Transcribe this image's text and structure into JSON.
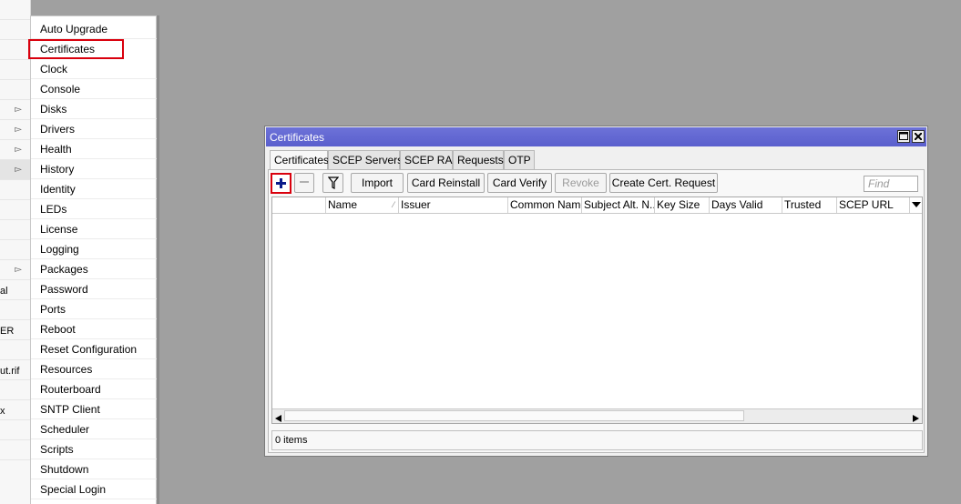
{
  "left_strip": {
    "fragments": [
      {
        "text": "al",
        "row": 14
      },
      {
        "text": "ER",
        "row": 16
      },
      {
        "text": "ut.rif",
        "row": 18
      },
      {
        "text": "x",
        "row": 20
      }
    ]
  },
  "submenu": {
    "items": [
      {
        "label": "Auto Upgrade"
      },
      {
        "label": "Certificates",
        "highlighted": true
      },
      {
        "label": "Clock"
      },
      {
        "label": "Console"
      },
      {
        "label": "Disks"
      },
      {
        "label": "Drivers"
      },
      {
        "label": "Health"
      },
      {
        "label": "History"
      },
      {
        "label": "Identity"
      },
      {
        "label": "LEDs"
      },
      {
        "label": "License"
      },
      {
        "label": "Logging"
      },
      {
        "label": "Packages"
      },
      {
        "label": "Password"
      },
      {
        "label": "Ports"
      },
      {
        "label": "Reboot"
      },
      {
        "label": "Reset Configuration"
      },
      {
        "label": "Resources"
      },
      {
        "label": "Routerboard"
      },
      {
        "label": "SNTP Client"
      },
      {
        "label": "Scheduler"
      },
      {
        "label": "Scripts"
      },
      {
        "label": "Shutdown"
      },
      {
        "label": "Special Login"
      }
    ]
  },
  "window": {
    "title": "Certificates",
    "tabs": [
      {
        "label": "Certificates",
        "active": true
      },
      {
        "label": "SCEP Servers"
      },
      {
        "label": "SCEP RA"
      },
      {
        "label": "Requests"
      },
      {
        "label": "OTP"
      }
    ],
    "toolbar": {
      "import": "Import",
      "card_reinstall": "Card Reinstall",
      "card_verify": "Card Verify",
      "revoke": "Revoke",
      "create_request": "Create Cert. Request",
      "find_placeholder": "Find"
    },
    "columns": [
      "",
      "Name",
      "Issuer",
      "Common Name",
      "Subject Alt. N...",
      "Key Size",
      "Days Valid",
      "Trusted",
      "SCEP URL"
    ],
    "status": "0 items"
  },
  "colors": {
    "titlebar": "#5a5fcd",
    "highlight": "#d9000d",
    "plus": "#0a1a8a"
  }
}
